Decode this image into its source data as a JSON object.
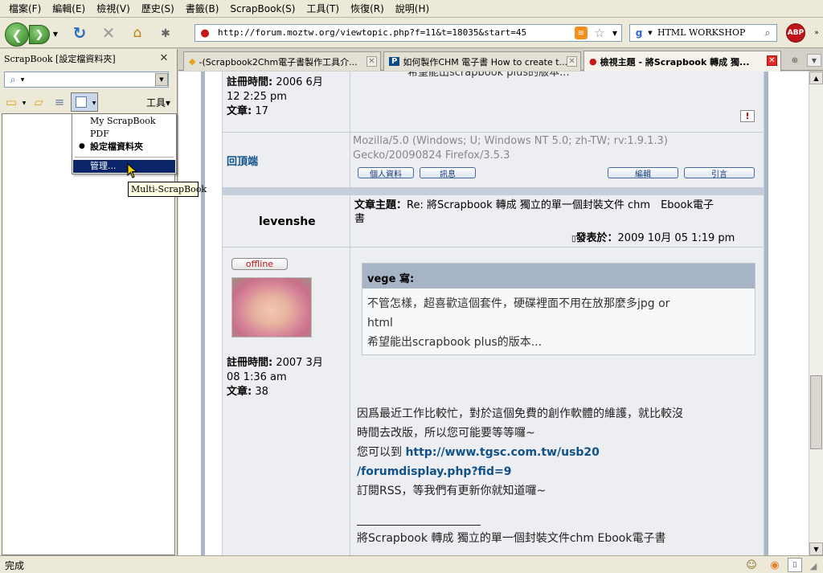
{
  "menubar": [
    "檔案(F)",
    "編輯(E)",
    "檢視(V)",
    "歷史(S)",
    "書籤(B)",
    "ScrapBook(S)",
    "工具(T)",
    "恢復(R)",
    "說明(H)"
  ],
  "nav": {
    "url": "http://forum.moztw.org/viewtopic.php?f=11&t=18035&start=45",
    "search_value": "HTML WORKSHOP"
  },
  "sidebar": {
    "title": "ScrapBook [設定檔資料夾]",
    "tools_label": "工具▾"
  },
  "dropdown": {
    "items": [
      "My ScrapBook",
      "PDF",
      "設定檔資料夾",
      "管理..."
    ],
    "checked_index": 2,
    "highlight_index": 3
  },
  "tooltip": "Multi-ScrapBook",
  "tabs": [
    {
      "label": "-(Scrapbook2Chm電子書製作工具介..."
    },
    {
      "label": "如何製作CHM 電子書 How to create t..."
    },
    {
      "label": "檢視主題 - 將Scrapbook 轉成 獨..."
    }
  ],
  "post1": {
    "partial_text": "希望能出scrapbook plus的版本...",
    "reg_label": "註冊時間:",
    "reg_value1": "2006 6月",
    "reg_value2": "12 2:25 pm",
    "posts_label": "文章:",
    "posts_value": "17",
    "back_to_top": "回頂端",
    "ua1": "Mozilla/5.0 (Windows; U; Windows NT 5.0; zh-TW; rv:1.9.1.3)",
    "ua2": "Gecko/20090824 Firefox/3.5.3",
    "btn_profile": "個人資料",
    "btn_pm": "訊息",
    "btn_edit": "編輯",
    "btn_quote": "引言"
  },
  "post2": {
    "author": "levenshe",
    "subject_label": "文章主題：",
    "subject1": "Re: 將Scrapbook 轉成 獨立的單一個封裝文件 chm　Ebook電子",
    "subject2": "書",
    "posted_label": "發表於：",
    "posted_value": "2009 10月 05 1:19 pm",
    "offline": "offline",
    "reg_label": "註冊時間:",
    "reg_value1": "2007 3月",
    "reg_value2": "08 1:36 am",
    "posts_label": "文章:",
    "posts_value": "38",
    "quote_author": "vege 寫:",
    "quote1": "不管怎樣，超喜歡這個套件，硬碟裡面不用在放那麼多jpg or",
    "quote2": "html",
    "quote3": "希望能出scrapbook plus的版本...",
    "body1": "因爲最近工作比較忙，對於這個免費的創作軟體的維護，就比較沒",
    "body2": "時間去改版，所以您可能要等等囉~",
    "body3_prefix": "您可以到 ",
    "link1": "http://www.tgsc.com.tw/usb20",
    "link2": "/forumdisplay.php?fid=9",
    "body4": "訂閱RSS，等我們有更新你就知道囉~",
    "signature": "將Scrapbook 轉成 獨立的單一個封裝文件chm Ebook電子書"
  },
  "status": "完成",
  "colors": {
    "link": "#105289",
    "header_bar": "#a6b4c6",
    "offline_red": "#c0141a"
  }
}
